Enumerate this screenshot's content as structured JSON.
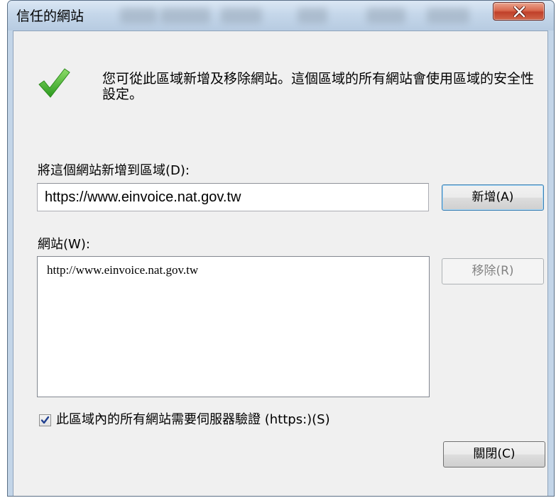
{
  "window": {
    "title": "信任的網站",
    "close_glyph": "x"
  },
  "info": {
    "icon": "green-check-icon",
    "text": "您可從此區域新增及移除網站。這個區域的所有網站會使用區域的安全性設定。"
  },
  "add_section": {
    "label": "將這個網站新增到區域(D):",
    "input_value": "https://www.einvoice.nat.gov.tw",
    "add_button": "新增(A)"
  },
  "sites_section": {
    "label": "網站(W):",
    "sites": [
      "http://www.einvoice.nat.gov.tw"
    ],
    "remove_button": "移除(R)"
  },
  "https_option": {
    "checked": true,
    "label": "此區域內的所有網站需要伺服器驗證 (https:)(S)"
  },
  "footer": {
    "close_button": "關閉(C)"
  },
  "colors": {
    "frame": "#c3d5e8",
    "client": "#f0f0f0",
    "close_red": "#c0402a",
    "check_green": "#3fae2a"
  }
}
